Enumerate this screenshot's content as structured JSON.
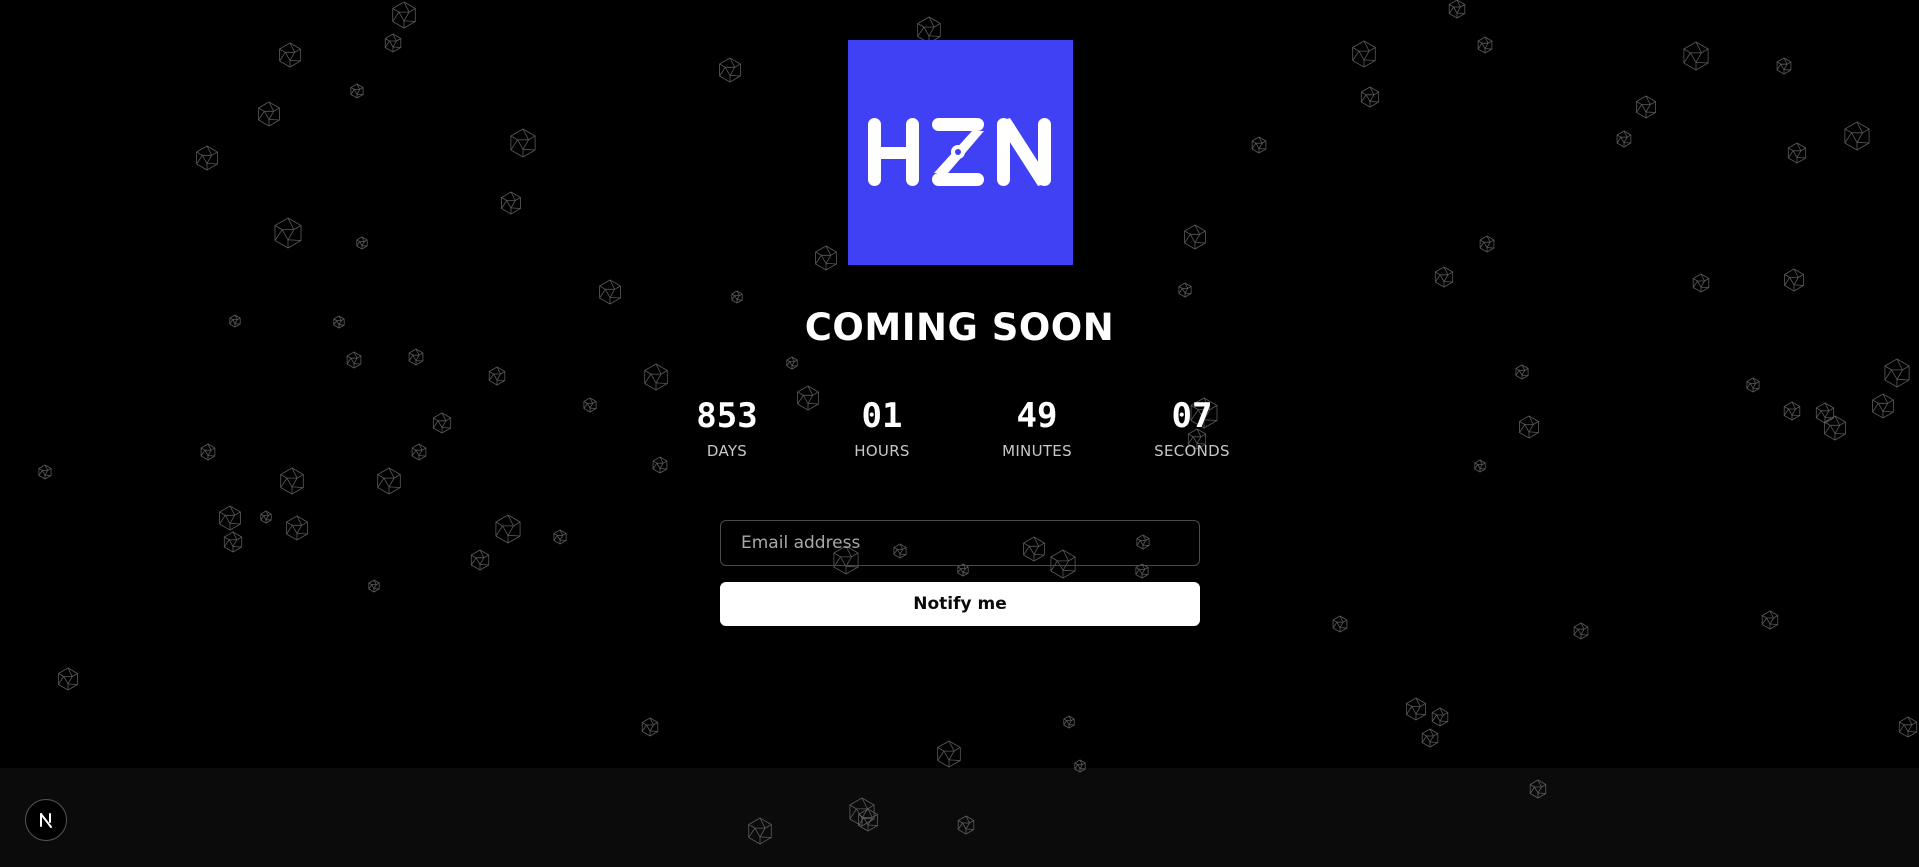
{
  "brand": {
    "logo_text": "HZN",
    "logo_color": "#4040f5"
  },
  "hero": {
    "title": "COMING SOON"
  },
  "countdown": {
    "units": [
      {
        "value": "853",
        "label": "DAYS"
      },
      {
        "value": "01",
        "label": "HOURS"
      },
      {
        "value": "49",
        "label": "MINUTES"
      },
      {
        "value": "07",
        "label": "SECONDS"
      }
    ]
  },
  "signup": {
    "email_placeholder": "Email address",
    "email_value": "",
    "button_label": "Notify me"
  },
  "dev_badge": {
    "icon": "nextjs-logo-icon",
    "letter": "N"
  },
  "background": {
    "page_color": "#000000",
    "footer_color": "#0b0b0b",
    "pattern_icon": "wireframe-polyhedron-icon"
  }
}
